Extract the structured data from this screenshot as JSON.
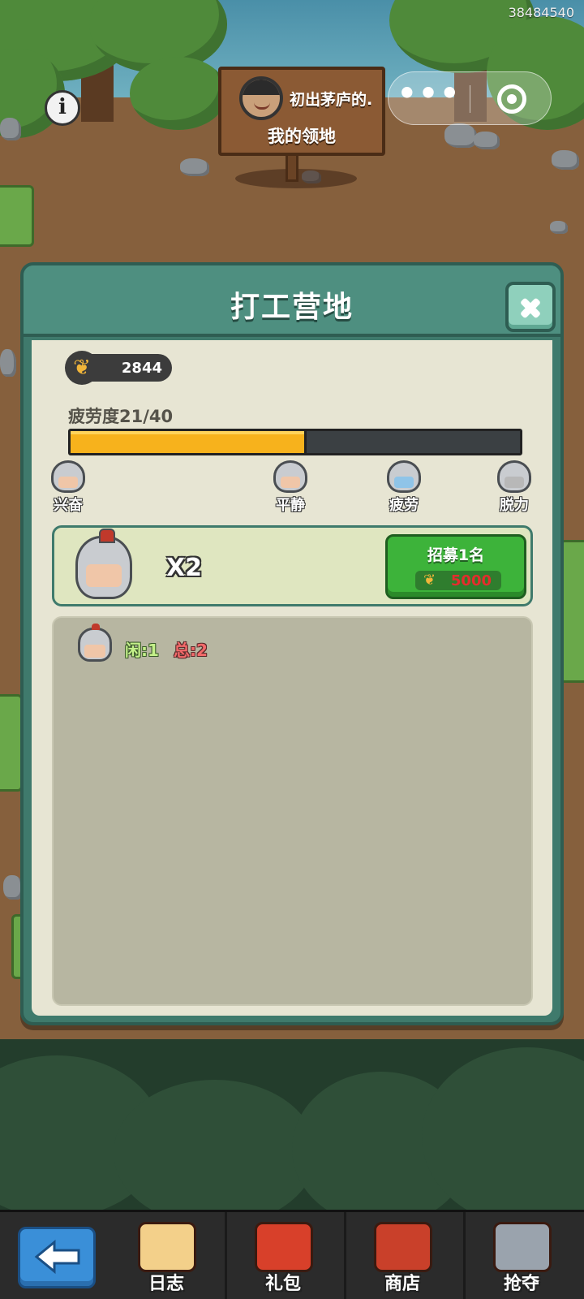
{
  "status": {
    "device_id": "38484540"
  },
  "header": {
    "player_name": "初出茅庐的.",
    "territory_label": "我的领地",
    "capsule_more": "•••"
  },
  "dialog": {
    "title": "打工营地",
    "gold": "2844",
    "fatigue_label": "疲劳度21/40",
    "fatigue_current": 21,
    "fatigue_max": 40,
    "states": [
      {
        "label": "兴奋",
        "icon": "excited-soldier-icon"
      },
      {
        "label": "平静",
        "icon": "calm-soldier-icon"
      },
      {
        "label": "疲劳",
        "icon": "tired-soldier-icon"
      },
      {
        "label": "脱力",
        "icon": "exhausted-soldier-icon"
      }
    ],
    "recruit": {
      "count": "X2",
      "button_label": "招募1名",
      "cost": "5000"
    },
    "workers": {
      "idle": "闲:1",
      "total": "总:2"
    }
  },
  "bottom_nav": [
    {
      "label": "日志",
      "icon": "scroll-icon",
      "color": "#f3d08a"
    },
    {
      "label": "礼包",
      "icon": "gift-sack-icon",
      "color": "#d8402a"
    },
    {
      "label": "商店",
      "icon": "shop-basket-icon",
      "color": "#c9402a"
    },
    {
      "label": "抢夺",
      "icon": "crossed-swords-shield-icon",
      "color": "#9aa3ad"
    }
  ],
  "colors": {
    "fatigue_fill": "#f7b21c",
    "recruit_button": "#3db33a",
    "back_button": "#3a8fd8"
  }
}
